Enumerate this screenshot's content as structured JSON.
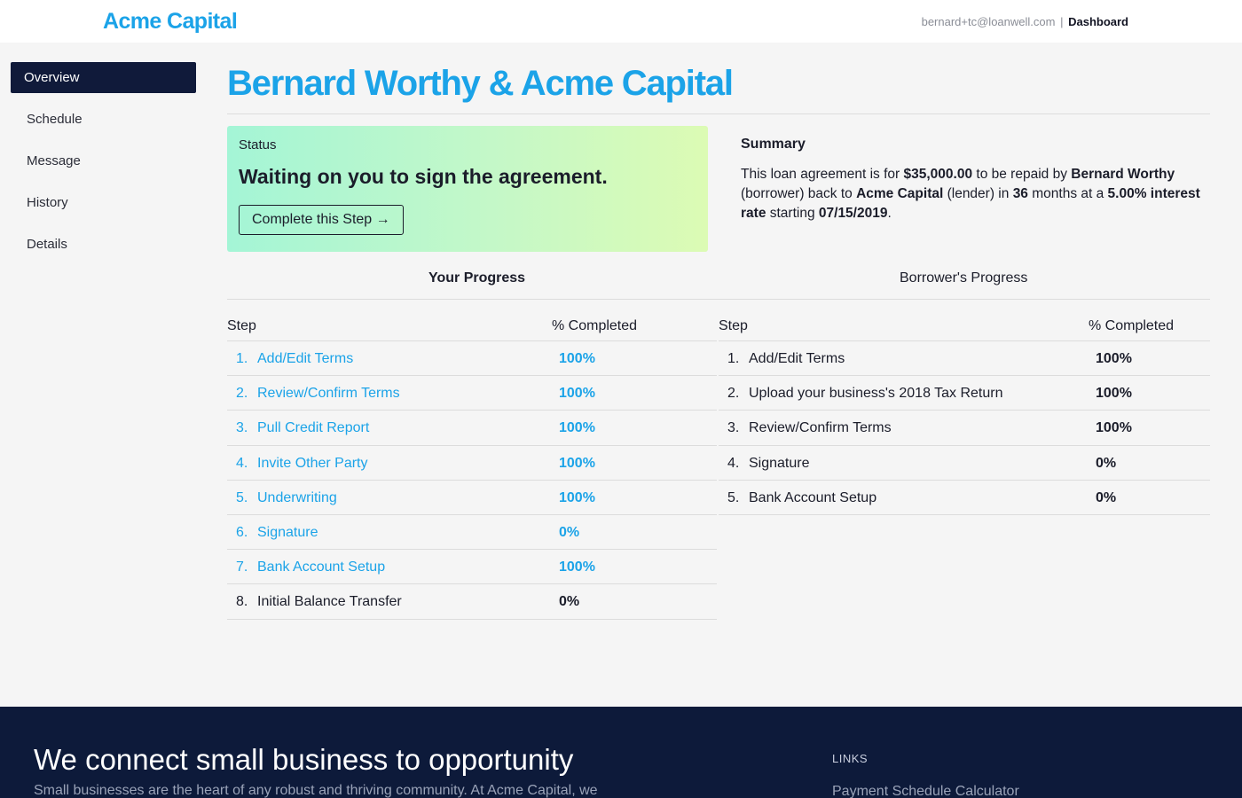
{
  "header": {
    "logo": "Acme Capital",
    "user_email": "bernard+tc@loanwell.com",
    "separator": "|",
    "dashboard_link": "Dashboard"
  },
  "sidebar": {
    "items": [
      {
        "label": "Overview",
        "active": true
      },
      {
        "label": "Schedule",
        "active": false
      },
      {
        "label": "Message",
        "active": false
      },
      {
        "label": "History",
        "active": false
      },
      {
        "label": "Details",
        "active": false
      }
    ]
  },
  "page": {
    "title": "Bernard Worthy & Acme Capital"
  },
  "status": {
    "label": "Status",
    "message": "Waiting on you to sign the agreement.",
    "button_label": "Complete this Step →"
  },
  "summary": {
    "title": "Summary",
    "t1": "This loan agreement is for ",
    "amount": "$35,000.00",
    "t2": " to be repaid by ",
    "borrower": "Bernard Worthy",
    "t3": " (borrower) back to ",
    "lender": "Acme Capital",
    "t4": " (lender) in ",
    "months": "36",
    "t5": " months at a ",
    "rate": "5.00% interest rate",
    "t6": " starting ",
    "start_date": "07/15/2019",
    "t7": "."
  },
  "your_progress": {
    "heading": "Your Progress",
    "col_step": "Step",
    "col_pct": "% Completed",
    "rows": [
      {
        "num": "1.",
        "label": "Add/Edit Terms",
        "pct": "100%"
      },
      {
        "num": "2.",
        "label": "Review/Confirm Terms",
        "pct": "100%"
      },
      {
        "num": "3.",
        "label": "Pull Credit Report",
        "pct": "100%"
      },
      {
        "num": "4.",
        "label": "Invite Other Party",
        "pct": "100%"
      },
      {
        "num": "5.",
        "label": "Underwriting",
        "pct": "100%"
      },
      {
        "num": "6.",
        "label": "Signature",
        "pct": "0%"
      },
      {
        "num": "7.",
        "label": "Bank Account Setup",
        "pct": "100%"
      },
      {
        "num": "8.",
        "label": "Initial Balance Transfer",
        "pct": "0%"
      }
    ]
  },
  "borrower_progress": {
    "heading": "Borrower's Progress",
    "col_step": "Step",
    "col_pct": "% Completed",
    "rows": [
      {
        "num": "1.",
        "label": "Add/Edit Terms",
        "pct": "100%"
      },
      {
        "num": "2.",
        "label": "Upload your business's 2018 Tax Return",
        "pct": "100%"
      },
      {
        "num": "3.",
        "label": "Review/Confirm Terms",
        "pct": "100%"
      },
      {
        "num": "4.",
        "label": "Signature",
        "pct": "0%"
      },
      {
        "num": "5.",
        "label": "Bank Account Setup",
        "pct": "0%"
      }
    ]
  },
  "footer": {
    "heading": "We connect small business to opportunity",
    "subtext": "Small businesses are the heart of any robust and thriving community. At Acme Capital, we",
    "links_title": "LINKS",
    "link_1": "Payment Schedule Calculator"
  },
  "colors": {
    "accent": "#1ba3e8",
    "nav_active_bg": "#101a3a",
    "footer_bg": "#0d1a3a",
    "status_gradient_start": "#a4f5d6",
    "status_gradient_end": "#dcfbb4"
  }
}
